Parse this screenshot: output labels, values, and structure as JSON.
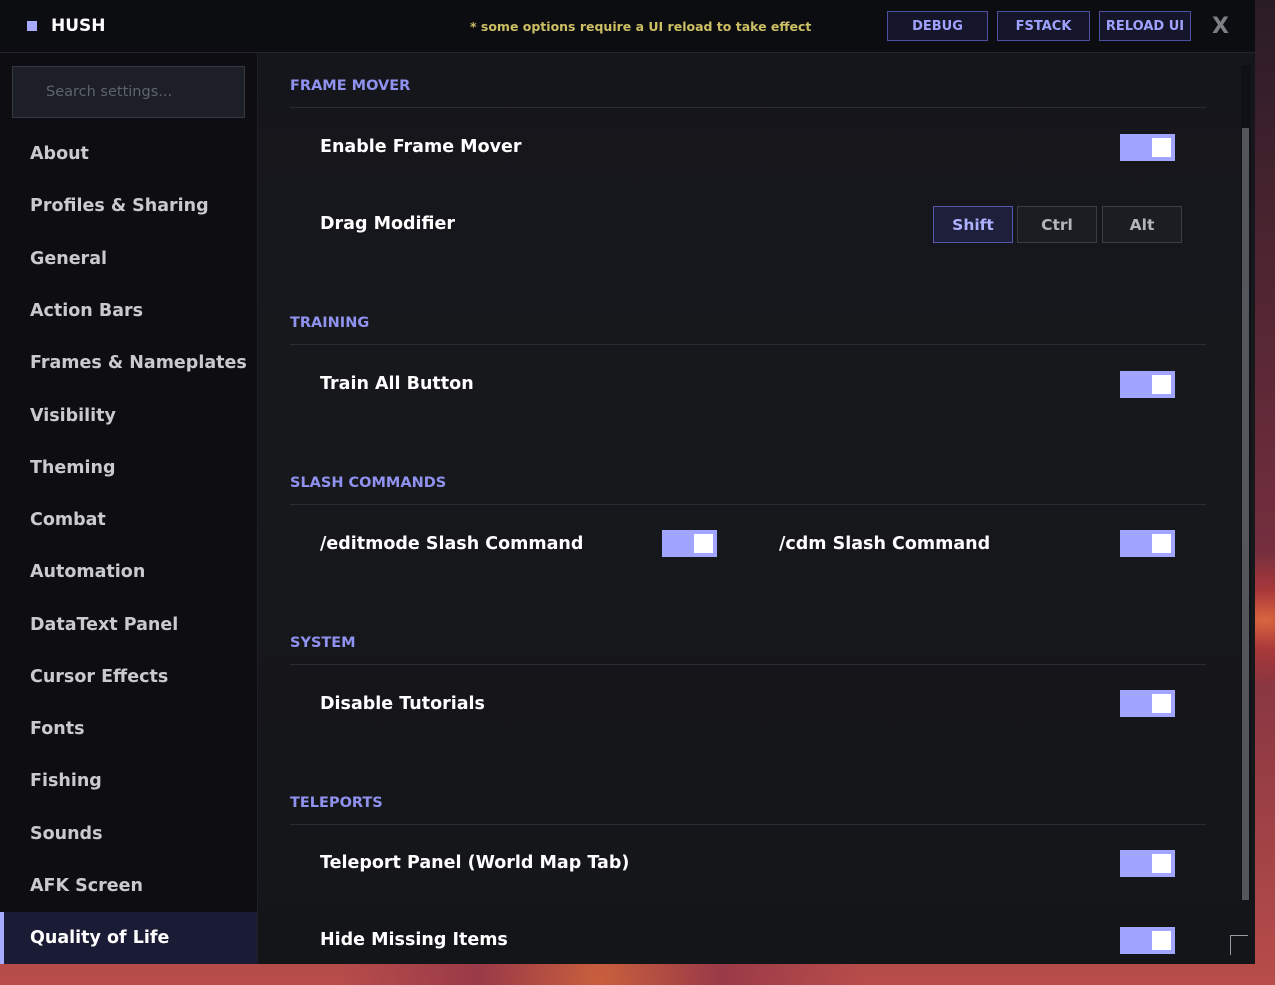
{
  "header": {
    "title": "HUSH",
    "notice": "* some options require a UI reload to take effect",
    "buttons": {
      "debug": "DEBUG",
      "fstack": "FSTACK",
      "reload": "RELOAD UI"
    },
    "close": "X",
    "accent": "#a7a9ff"
  },
  "sidebar": {
    "search_placeholder": "Search settings...",
    "items": [
      "About",
      "Profiles & Sharing",
      "General",
      "Action Bars",
      "Frames & Nameplates",
      "Visibility",
      "Theming",
      "Combat",
      "Automation",
      "DataText Panel",
      "Cursor Effects",
      "Fonts",
      "Fishing",
      "Sounds",
      "AFK Screen",
      "Quality of Life"
    ],
    "active_item": "Quality of Life"
  },
  "sections": {
    "frame_mover": {
      "title": "FRAME MOVER",
      "enable_label": "Enable Frame Mover",
      "enable_on": true,
      "drag_label": "Drag Modifier",
      "drag_options": [
        "Shift",
        "Ctrl",
        "Alt"
      ],
      "drag_selected": "Shift"
    },
    "training": {
      "title": "TRAINING",
      "train_all_label": "Train All Button",
      "train_all_on": true
    },
    "slash_commands": {
      "title": "SLASH COMMANDS",
      "editmode_label": "/editmode Slash Command",
      "editmode_on": true,
      "cdm_label": "/cdm Slash Command",
      "cdm_on": true
    },
    "system": {
      "title": "SYSTEM",
      "tutorials_label": "Disable Tutorials",
      "tutorials_on": true
    },
    "teleports": {
      "title": "TELEPORTS",
      "panel_label": "Teleport Panel (World Map Tab)",
      "panel_on": true,
      "hide_missing_label": "Hide Missing Items",
      "hide_missing_on": true
    }
  }
}
